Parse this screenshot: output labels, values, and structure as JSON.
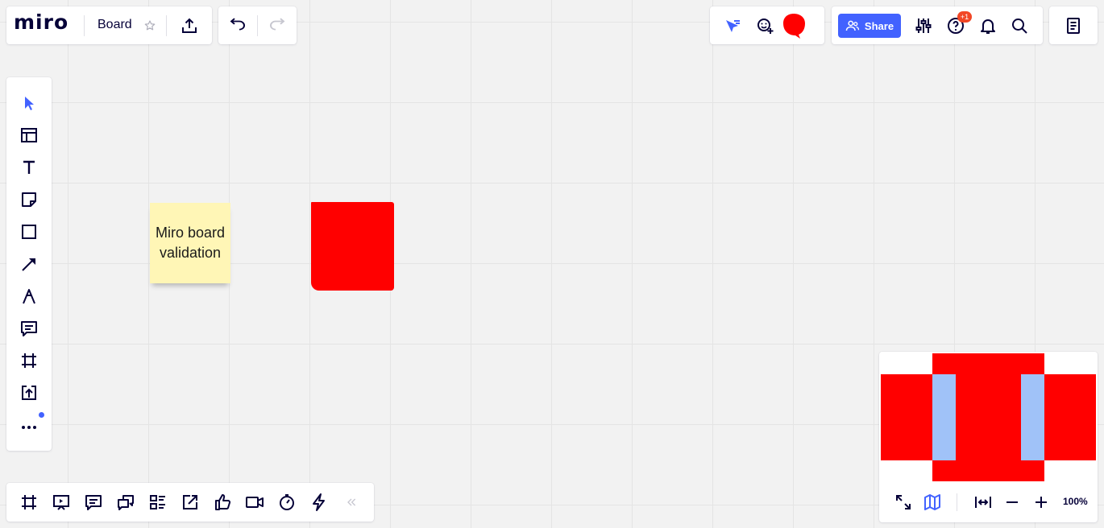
{
  "header": {
    "logo_text": "miro",
    "board_name": "Board",
    "share_label": "Share",
    "notifications_badge": "+1"
  },
  "left_toolbar": {
    "items": [
      "select-icon",
      "templates-icon",
      "text-icon",
      "sticky-note-icon",
      "shape-icon",
      "connection-line-icon",
      "pen-icon",
      "comment-icon",
      "frame-icon",
      "upload-icon",
      "more-tools-icon"
    ]
  },
  "bottom_toolbar": {
    "items": [
      "frames-icon",
      "presentation-icon",
      "comments-icon",
      "chat-icon",
      "card-list-icon",
      "share-screen-icon",
      "voting-icon",
      "video-call-icon",
      "timer-icon",
      "integrations-icon",
      "collapse-icon"
    ]
  },
  "canvas": {
    "sticky_note_text": "Miro board validation",
    "sticky_color": "#fff6b6",
    "red_shape_color": "#ff0000"
  },
  "minimap": {
    "zoom_label": "100%",
    "accent_color": "#4262ff"
  }
}
